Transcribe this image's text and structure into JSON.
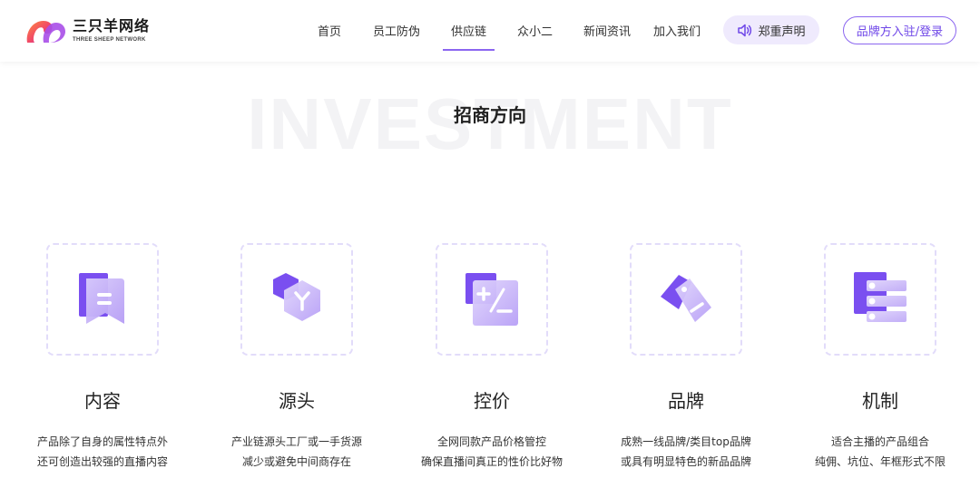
{
  "brand": {
    "name_cn": "三只羊网络",
    "name_en": "THREE SHEEP NETWORK"
  },
  "nav": {
    "items": [
      {
        "label": "首页"
      },
      {
        "label": "员工防伪"
      },
      {
        "label": "供应链",
        "active": true
      },
      {
        "label": "众小二"
      },
      {
        "label": "新闻资讯"
      },
      {
        "label": "加入我们"
      }
    ],
    "notice_label": "郑重声明",
    "login_label": "品牌方入驻/登录"
  },
  "section": {
    "bg_word": "INVESTMENT",
    "title": "招商方向"
  },
  "cards": [
    {
      "title": "内容",
      "icon": "bookmark-icon",
      "lines": [
        "产品除了自身的属性特点外",
        "还可创造出较强的直播内容"
      ]
    },
    {
      "title": "源头",
      "icon": "hexagon-y-icon",
      "lines": [
        "产业链源头工厂或一手货源",
        "减少或避免中间商存在"
      ]
    },
    {
      "title": "控价",
      "icon": "calculator-icon",
      "lines": [
        "全网同款产品价格管控",
        "确保直播间真正的性价比好物"
      ]
    },
    {
      "title": "品牌",
      "icon": "tag-icon",
      "lines": [
        "成熟一线品牌/类目top品牌",
        "或具有明显特色的新品品牌"
      ]
    },
    {
      "title": "机制",
      "icon": "list-toggle-icon",
      "lines": [
        "适合主播的产品组合",
        "纯佣、坑位、年框形式不限"
      ]
    }
  ],
  "colors": {
    "accent": "#8b66f0",
    "accent_dark": "#6f47e8",
    "accent_light": "#efeafd",
    "dashed_border": "#e2dcfa"
  }
}
